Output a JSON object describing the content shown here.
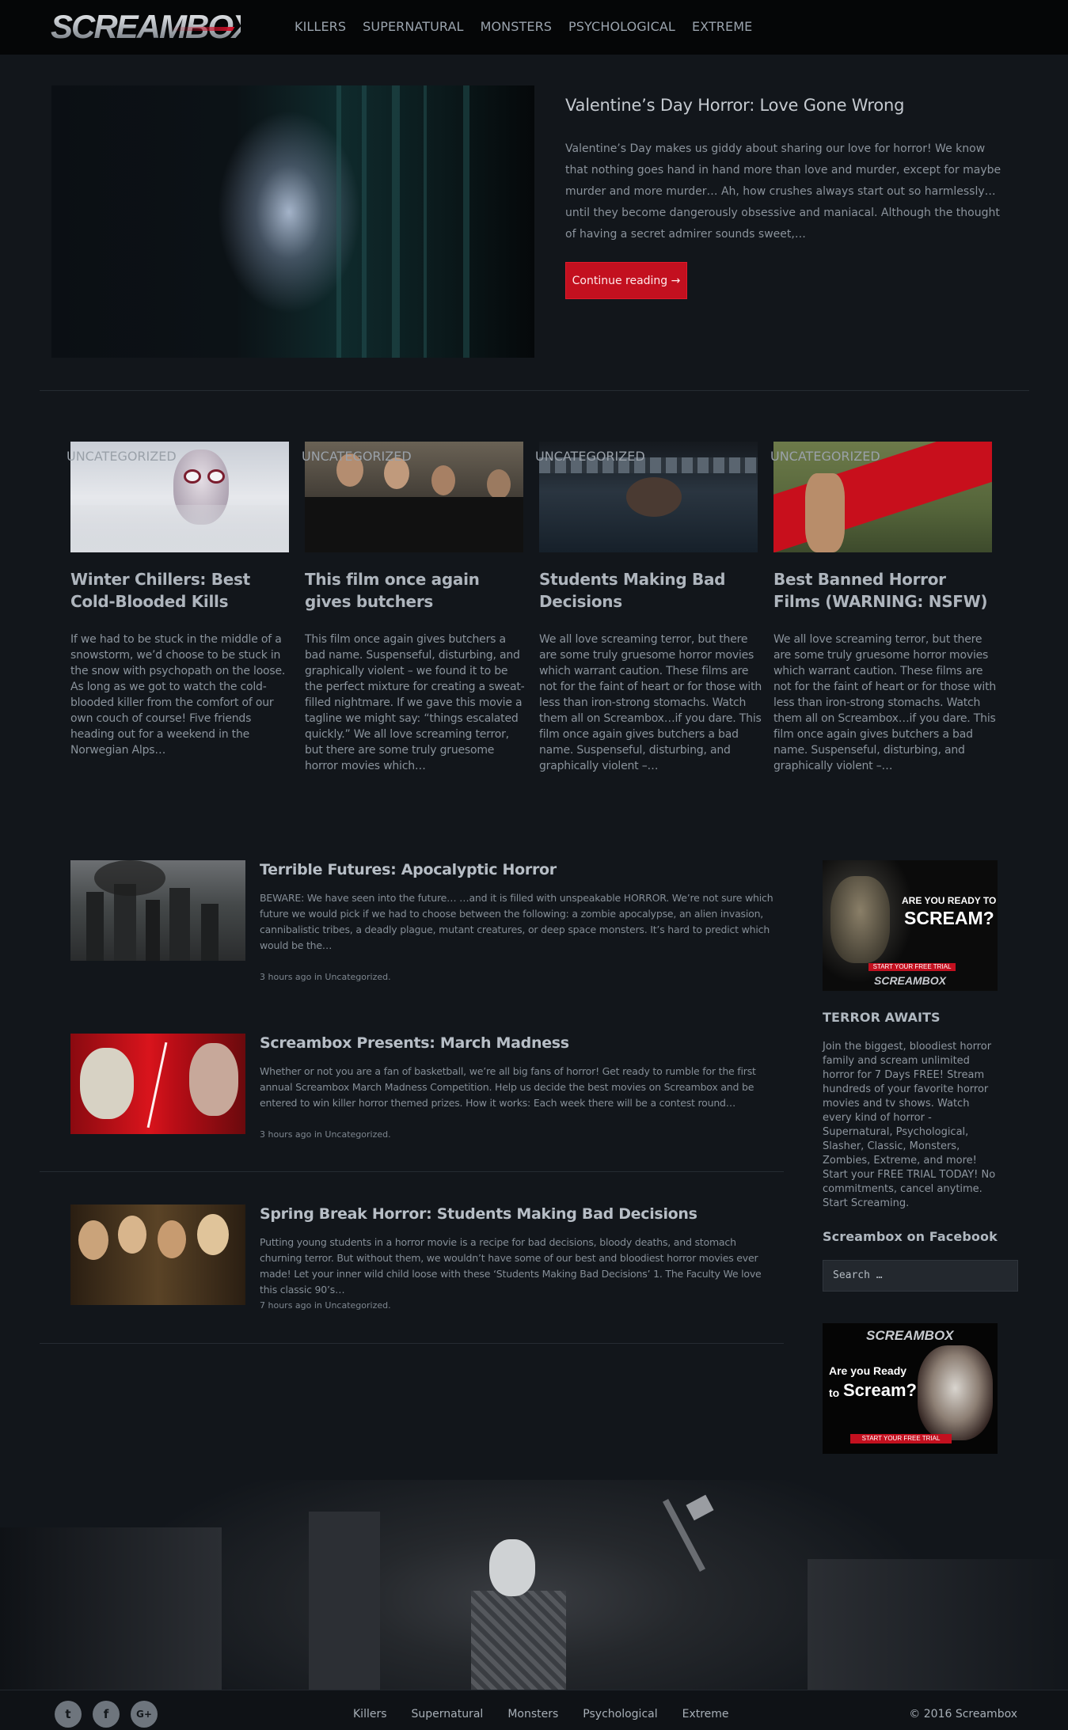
{
  "header": {
    "logo": "SCREAMBOX",
    "nav": [
      "KILLERS",
      "SUPERNATURAL",
      "MONSTERS",
      "PSYCHOLOGICAL",
      "EXTREME"
    ]
  },
  "hero": {
    "title": "Valentine’s Day Horror: Love Gone Wrong",
    "text": "Valentine’s Day makes us giddy about sharing our love for horror! We know that nothing goes hand in hand more than love and murder, except for maybe murder and more murder… Ah, how crushes always start out so harmlessly…until they become dangerously obsessive and maniacal. Although the thought of having a secret admirer sounds sweet,…",
    "button": "Continue reading →"
  },
  "cards": [
    {
      "badge": "UNCATEGORIZED",
      "title": "Winter Chillers: Best Cold-Blooded Kills",
      "text": "If we had to be stuck in the middle of a snowstorm, we’d choose to be stuck in the snow with psychopath on the loose. As long as we got to watch the cold-blooded killer from the comfort of our own couch of course! Five friends heading out for a weekend in the Norwegian Alps…"
    },
    {
      "badge": "UNCATEGORIZED",
      "title": "This film once again gives butchers",
      "text": "This film once again gives butchers a bad name. Suspenseful, disturbing, and graphically violent – we found it to be the perfect mixture for creating a sweat-filled nightmare. If we gave this movie a tagline we might say: “things escalated quickly.” We all love screaming terror, but there are some truly gruesome horror movies which…"
    },
    {
      "badge": "UNCATEGORIZED",
      "title": "Students Making Bad Decisions",
      "text": "We all love screaming terror, but there are some truly gruesome horror movies which warrant caution. These films are not for the faint of heart or for those with less than iron-strong stomachs. Watch them all on Screambox…if you dare. This film once again gives butchers a bad name. Suspenseful, disturbing, and graphically violent –…"
    },
    {
      "badge": "UNCATEGORIZED",
      "title": "Best Banned Horror Films (WARNING: NSFW)",
      "text": "We all love screaming terror, but there are some truly gruesome horror movies which warrant caution. These films are not for the faint of heart or for those with less than iron-strong stomachs. Watch them all on Screambox…if you dare. This film once again gives butchers a bad name. Suspenseful, disturbing, and graphically violent –…"
    }
  ],
  "posts": [
    {
      "title": "Terrible Futures: Apocalyptic Horror",
      "text": "BEWARE: We have seen into the future… …and it is filled with unspeakable HORROR. We’re not sure which future we would pick if we had to choose between the following: a zombie apocalypse, an alien invasion, cannibalistic tribes, a deadly plague, mutant creatures, or deep space monsters. It’s hard to predict which would be the…",
      "meta": "3 hours ago in Uncategorized."
    },
    {
      "title": "Screambox Presents: March Madness",
      "text": "Whether or not you are a fan of basketball, we’re all big fans of horror! Get ready to rumble for the first annual Screambox March Madness Competition. Help us decide the best movies on Screambox and be entered to win killer horror themed prizes. How it works: Each week there will be a contest round…",
      "meta": "3 hours ago in Uncategorized."
    },
    {
      "title": "Spring Break Horror: Students Making Bad Decisions",
      "text": "Putting young students in a horror movie is a recipe for bad decisions, bloody deaths, and stomach churning terror. But without them, we wouldn’t have some of our best and bloodiest horror movies ever made! Let your inner wild child loose with these ‘Students Making Bad Decisions’ 1. The Faculty We love this classic 90’s…",
      "meta": "7 hours ago in Uncategorized."
    }
  ],
  "sidebar": {
    "ad1": {
      "line1": "ARE YOU READY TO",
      "line2": "SCREAM?",
      "button": "START YOUR FREE TRIAL",
      "brand": "SCREAMBOX"
    },
    "terror_title": "TERROR AWAITS",
    "terror_text": "Join the biggest, bloodiest horror family and scream unlimited horror for 7 Days FREE! Stream hundreds of your favorite horror movies and tv shows. Watch every kind of horror - Supernatural, Psychological, Slasher, Classic, Monsters, Zombies, Extreme, and more! Start your FREE TRIAL TODAY! No commitments, cancel anytime. Start Screaming.",
    "facebook_title": "Screambox on Facebook",
    "search_placeholder": "Search …",
    "ad2": {
      "brand": "SCREAMBOX",
      "line1": "Are you Ready",
      "line2a": "to",
      "line2b": "Scream?",
      "button": "START YOUR FREE TRIAL"
    }
  },
  "footer": {
    "social_icons": [
      "twitter-icon",
      "facebook-icon",
      "google-plus-icon"
    ],
    "social_glyphs": [
      "t",
      "f",
      "G+"
    ],
    "nav": [
      "Killers",
      "Supernatural",
      "Monsters",
      "Psychological",
      "Extreme"
    ],
    "copyright": "© 2016 Screambox"
  },
  "colors": {
    "accent": "#c3101f",
    "background": "#12161b",
    "topbar": "#050607"
  }
}
